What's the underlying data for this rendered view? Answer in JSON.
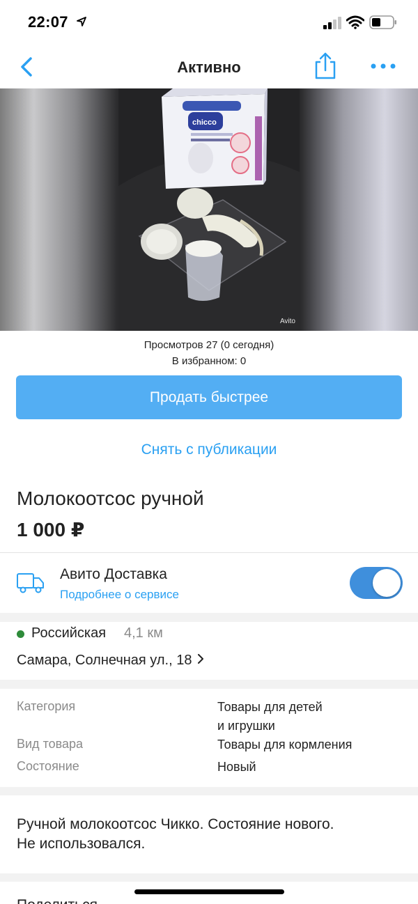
{
  "status_bar": {
    "time": "22:07"
  },
  "nav": {
    "title": "Активно",
    "icons": [
      "chevron-left-icon",
      "share-icon",
      "more-icon"
    ],
    "accent": "#2aa0f2"
  },
  "photo": {
    "watermark": "Avito",
    "box_brand": "chicco"
  },
  "stats": {
    "views": "Просмотров 27 (0 сегодня)",
    "favorites": "В избранном: 0"
  },
  "actions": {
    "sell_faster": "Продать быстрее",
    "unpublish": "Снять с публикации",
    "primary_color": "#53aef3"
  },
  "listing": {
    "title": "Молокоотсос ручной",
    "price": "1 000 ₽"
  },
  "delivery": {
    "title": "Авито Доставка",
    "link": "Подробнее о сервисе",
    "enabled": true,
    "icon": "truck-icon"
  },
  "location": {
    "metro": "Российская",
    "distance": "4,1 км",
    "address": "Самара, Солнечная ул., 18",
    "metro_color": "#2e8b3a"
  },
  "params": [
    {
      "label": "Категория",
      "value_line1": "Товары для детей",
      "value_line2": "и игрушки"
    },
    {
      "label": "Вид товара",
      "value_line1": "Товары для кормления"
    },
    {
      "label": "Состояние",
      "value_line1": "Новый"
    }
  ],
  "description": {
    "line1": "Ручной молокоотсос Чикко. Состояние нового.",
    "line2": "Не использовался."
  },
  "share": {
    "label": "Поделиться"
  }
}
